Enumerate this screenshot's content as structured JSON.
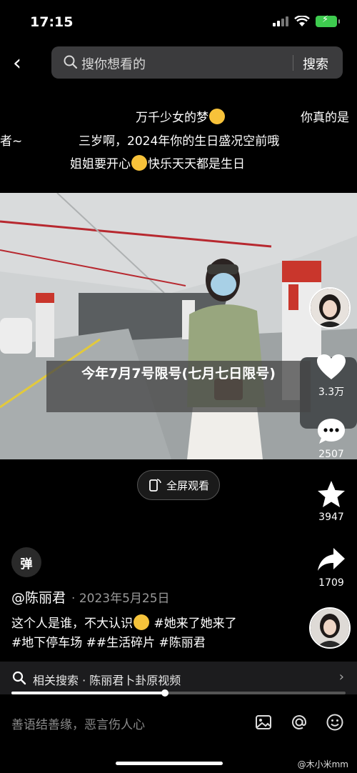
{
  "status_bar": {
    "time": "17:15"
  },
  "search": {
    "placeholder": "搜你想看的",
    "button": "搜索"
  },
  "captions": {
    "line1_main": "万千少女的梦",
    "line1_right": "你真的是",
    "line2_left": "者~",
    "line2_main": "三岁啊，2024年你的生日盛况空前哦",
    "line3_a": "姐姐要开心",
    "line3_b": "快乐天天都是生日"
  },
  "video": {
    "overlay_title": "今年7月7号限号(七月七日限号)"
  },
  "rail": {
    "likes": "3.3万",
    "comments": "2507",
    "favorites": "3947",
    "shares": "1709"
  },
  "fullscreen_label": "全屏观看",
  "danmu_label": "弹",
  "post": {
    "author": "@陈丽君",
    "date": "· 2023年5月25日",
    "desc_line1_a": "这个人是谁，不大认识",
    "desc_line1_b": "#她来了她来了",
    "desc_line2": "#地下停车场 ##生活碎片 #陈丽君"
  },
  "related": {
    "text": "相关搜索 · 陈丽君卜卦原视频",
    "progress": 0.46
  },
  "comment_placeholder": "善语结善缘，恶言伤人心",
  "watermark": "@木小米mm"
}
